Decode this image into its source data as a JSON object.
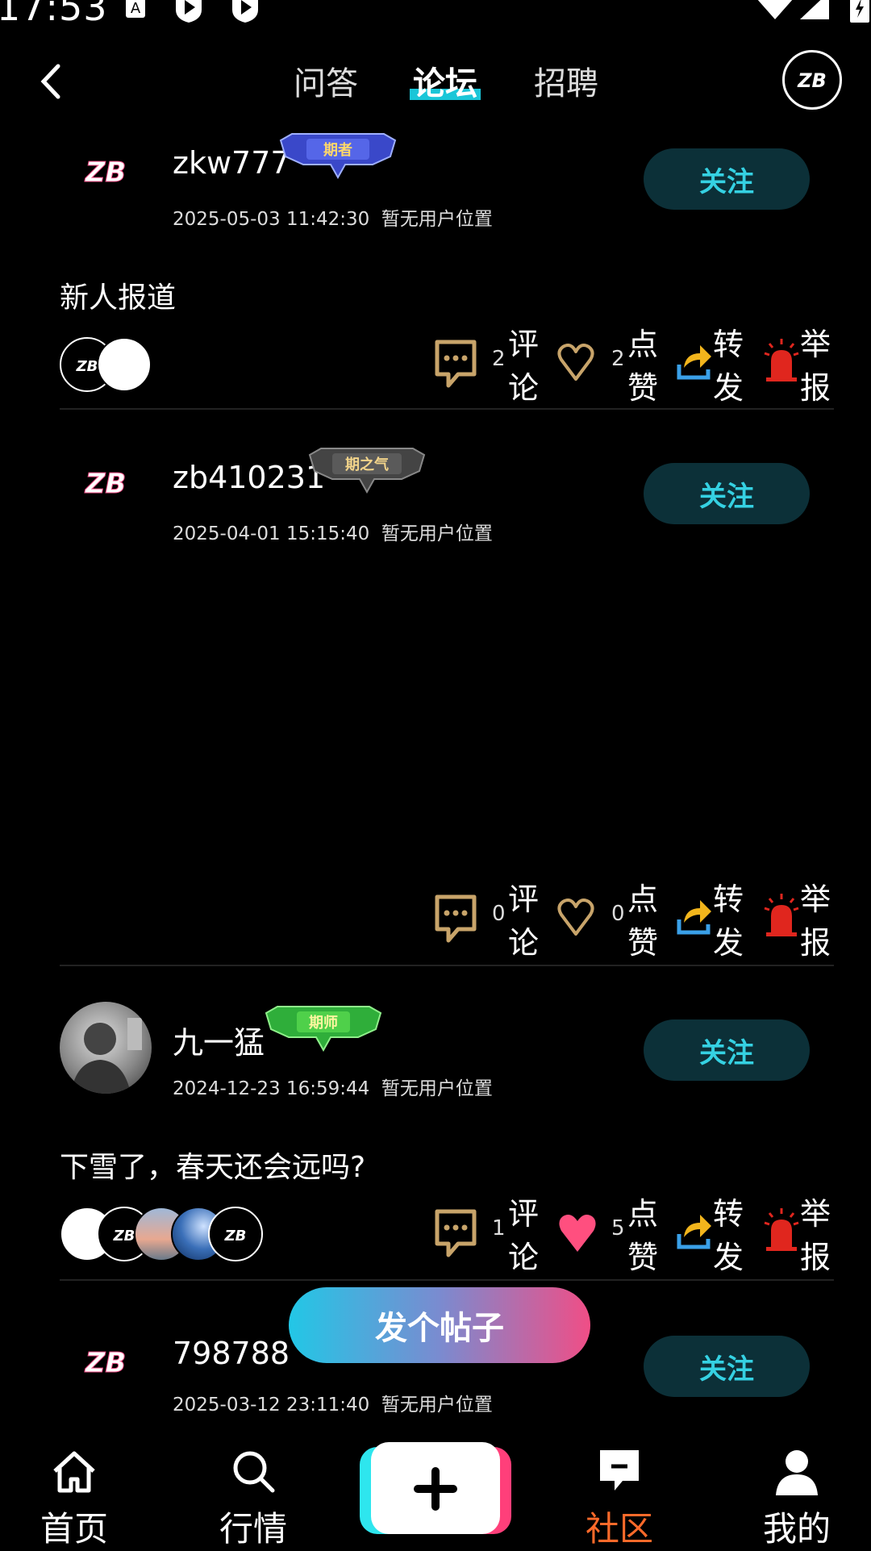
{
  "status_bar": {
    "time": "17:53"
  },
  "top_tabs": [
    {
      "label": "问答",
      "active": false
    },
    {
      "label": "论坛",
      "active": true
    },
    {
      "label": "招聘",
      "active": false
    }
  ],
  "colors": {
    "accent": "#1bc6d8",
    "follow_text": "#35d1e2",
    "follow_bg": "#0c3038",
    "active_nav": "#ff6a2a",
    "like_active": "#ff4f7f",
    "icon_gold": "#c8a46a"
  },
  "posts": [
    {
      "username": "zkw777",
      "badge": "期者",
      "datetime": "2025-05-03 11:42:30",
      "location": "暂无用户位置",
      "follow_label": "关注",
      "text": "新人报道",
      "comments": "2",
      "likes": "2",
      "liked": false
    },
    {
      "username": "zb410231",
      "badge": "期之气",
      "datetime": "2025-04-01 15:15:40",
      "location": "暂无用户位置",
      "follow_label": "关注",
      "text": "",
      "comments": "0",
      "likes": "0",
      "liked": false
    },
    {
      "username": "九一猛",
      "badge": "期师",
      "datetime": "2024-12-23 16:59:44",
      "location": "暂无用户位置",
      "follow_label": "关注",
      "text": "下雪了，春天还会远吗?",
      "comments": "1",
      "likes": "5",
      "liked": true
    },
    {
      "username": "798788",
      "datetime": "2025-03-12 23:11:40",
      "location": "暂无用户位置",
      "follow_label": "关注"
    }
  ],
  "action_labels": {
    "comment": "评论",
    "like": "点赞",
    "share": "转发",
    "report": "举报"
  },
  "fab_label": "发个帖子",
  "bottom_nav": [
    {
      "label": "首页",
      "icon": "home-icon",
      "active": false
    },
    {
      "label": "行情",
      "icon": "search-icon",
      "active": false
    },
    {
      "label": "",
      "icon": "plus-icon",
      "active": false
    },
    {
      "label": "社区",
      "icon": "message-icon",
      "active": true
    },
    {
      "label": "我的",
      "icon": "user-icon",
      "active": false
    }
  ]
}
